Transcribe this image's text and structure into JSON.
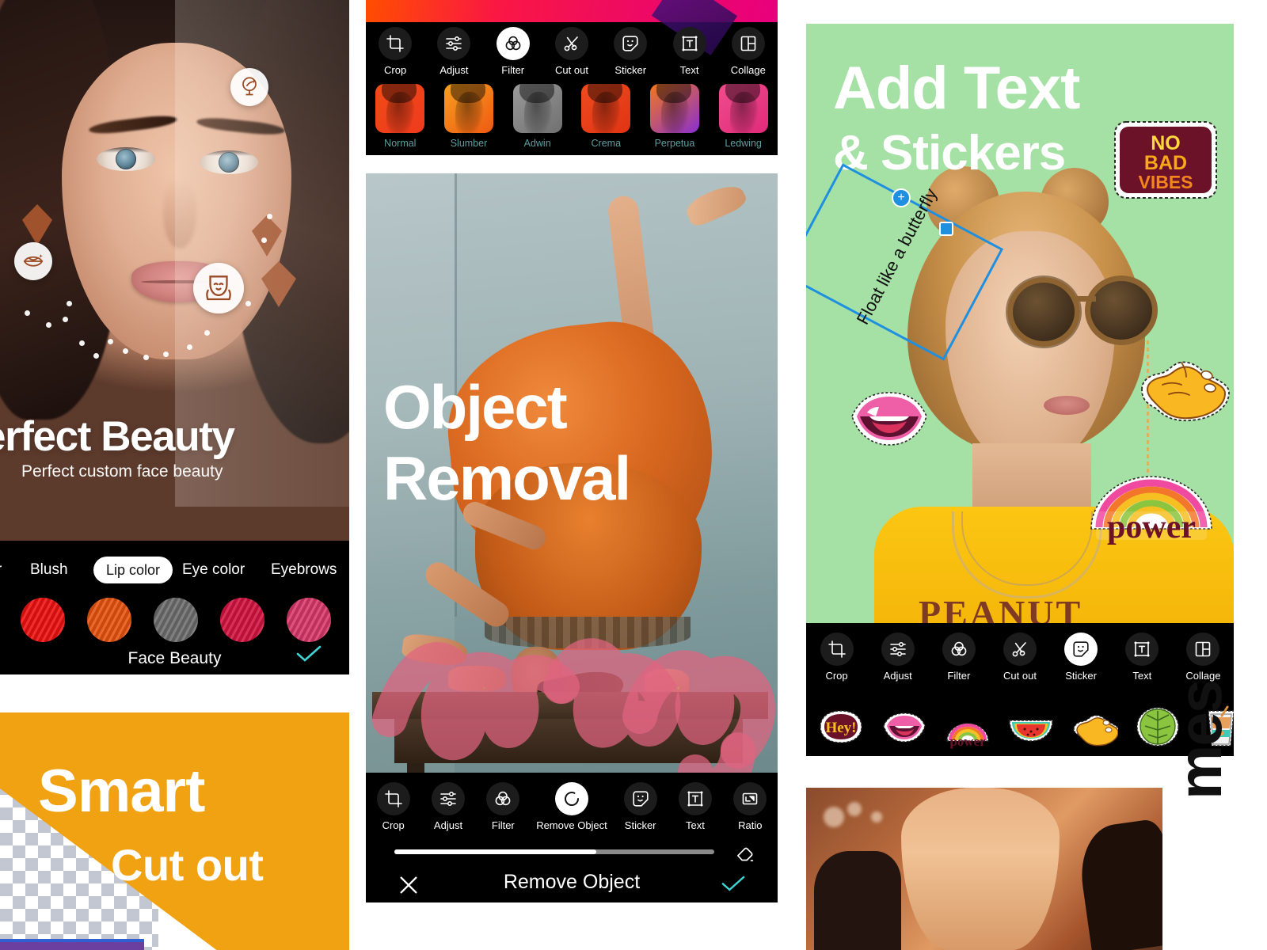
{
  "beauty_panel": {
    "title": "erfect Beauty",
    "subtitle": "Perfect custom face beauty",
    "badges": [
      {
        "name": "mirror-sparkle-icon"
      },
      {
        "name": "lips-sparkle-icon"
      },
      {
        "name": "face-beauty-icon"
      }
    ],
    "tabs": [
      {
        "label": "r",
        "selected": false
      },
      {
        "label": "Blush",
        "selected": false
      },
      {
        "label": "Lip color",
        "selected": true
      },
      {
        "label": "Eye color",
        "selected": false
      },
      {
        "label": "Eyebrows",
        "selected": false
      }
    ],
    "swatches": [
      "#ef1111",
      "#e85410",
      "#6e6e6e",
      "#d41441",
      "#d93a6a"
    ],
    "bar_label": "Face Beauty",
    "confirm_icon": "check-icon",
    "check_color": "#3fd4d4"
  },
  "cutout_panel": {
    "title_line1": "Smart",
    "title_line2": "Cut out",
    "bg_color": "#f0a213",
    "accent_blue": "#2f5fd0",
    "accent_purple": "#6b3fa0"
  },
  "filter_panel": {
    "toolbar": [
      {
        "label": "Crop",
        "icon": "crop-icon",
        "active": false
      },
      {
        "label": "Adjust",
        "icon": "sliders-icon",
        "active": false
      },
      {
        "label": "Filter",
        "icon": "filter-circles-icon",
        "active": true
      },
      {
        "label": "Cut out",
        "icon": "scissors-icon",
        "active": false
      },
      {
        "label": "Sticker",
        "icon": "sticker-face-icon",
        "active": false
      },
      {
        "label": "Text",
        "icon": "text-box-icon",
        "active": false
      },
      {
        "label": "Collage",
        "icon": "collage-grid-icon",
        "active": false
      }
    ],
    "filters": [
      {
        "label": "Normal",
        "color1": "#f04b16",
        "color2": "#ef3a1e"
      },
      {
        "label": "Slumber",
        "color1": "#f5a020",
        "color2": "#ef5a12"
      },
      {
        "label": "Adwin",
        "color1": "#9a9a9a",
        "color2": "#707070"
      },
      {
        "label": "Crema",
        "color1": "#ef4b20",
        "color2": "#e03413"
      },
      {
        "label": "Perpetua",
        "color1": "#f0781c",
        "color2": "#8a2fd0"
      },
      {
        "label": "Ledwing",
        "color1": "#ef4d8c",
        "color2": "#e02a7a"
      }
    ],
    "label_color": "#5f9ea0"
  },
  "remove_panel": {
    "title_line1": "Object",
    "title_line2": "Removal",
    "toolbar": [
      {
        "label": "Crop",
        "icon": "crop-icon",
        "active": false
      },
      {
        "label": "Adjust",
        "icon": "sliders-icon",
        "active": false
      },
      {
        "label": "Filter",
        "icon": "filter-circles-icon",
        "active": false
      },
      {
        "label": "Remove Object",
        "icon": "brush-ring-icon",
        "active": true
      },
      {
        "label": "Sticker",
        "icon": "sticker-face-icon",
        "active": false
      },
      {
        "label": "Text",
        "icon": "text-box-icon",
        "active": false
      },
      {
        "label": "Ratio",
        "icon": "ratio-icon",
        "active": false
      }
    ],
    "slider_percent": 63,
    "eraser_icon": "eraser-icon",
    "cancel_icon": "close-icon",
    "confirm_title": "Remove Object",
    "confirm_icon": "check-icon",
    "check_color": "#3fd4d4",
    "mask_color": "#e0647f"
  },
  "sticker_panel": {
    "title_line1": "Add Text",
    "title_line2": "& Stickers",
    "bg_color": "#a5e0a5",
    "text_layer": "Float like a butterfly",
    "selection_color": "#1f8fe0",
    "handle_add_icon": "add-handle-icon",
    "handle_resize_icon": "resize-handle-icon",
    "sweater_text": "PEANUT",
    "canvas_stickers": [
      {
        "name": "no-bad-vibes-sticker",
        "lines": [
          "NO",
          "BAD",
          "VIBES"
        ]
      },
      {
        "name": "pink-lips-sticker"
      },
      {
        "name": "power-rainbow-sticker",
        "label": "power"
      },
      {
        "name": "shaka-hand-sticker"
      }
    ],
    "toolbar": [
      {
        "label": "Crop",
        "icon": "crop-icon",
        "active": false
      },
      {
        "label": "Adjust",
        "icon": "sliders-icon",
        "active": false
      },
      {
        "label": "Filter",
        "icon": "filter-circles-icon",
        "active": false
      },
      {
        "label": "Cut out",
        "icon": "scissors-icon",
        "active": false
      },
      {
        "label": "Sticker",
        "icon": "sticker-face-icon",
        "active": true
      },
      {
        "label": "Text",
        "icon": "text-box-icon",
        "active": false
      },
      {
        "label": "Collage",
        "icon": "collage-grid-icon",
        "active": false
      }
    ],
    "sticker_strip": [
      {
        "name": "hey-sticker",
        "label": "Hey!"
      },
      {
        "name": "lips-sticker",
        "label": ""
      },
      {
        "name": "power-rainbow-sticker",
        "label": "power"
      },
      {
        "name": "watermelon-sticker",
        "label": ""
      },
      {
        "name": "shaka-hand-sticker",
        "label": ""
      },
      {
        "name": "monstera-leaf-sticker",
        "label": ""
      },
      {
        "name": "drink-cup-sticker",
        "label": ""
      },
      {
        "name": "partial-sticker",
        "label": ""
      }
    ]
  },
  "photo_panel": {
    "name": "blonde-woman-orange-photo"
  },
  "side_text": {
    "label": "mes"
  }
}
